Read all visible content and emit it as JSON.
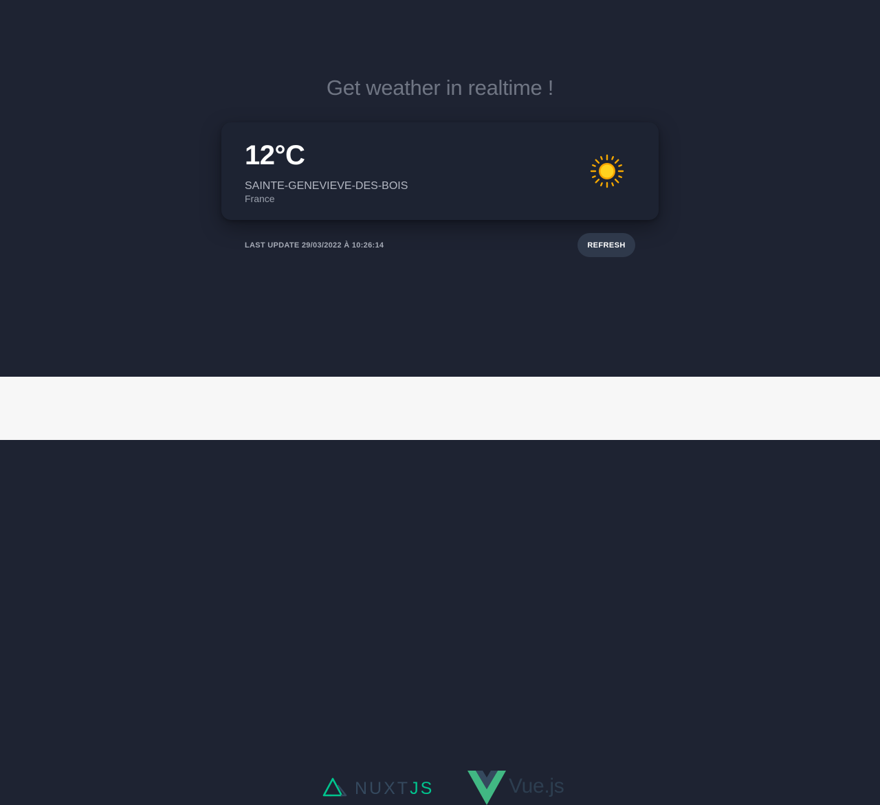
{
  "header": {
    "headline": "Get weather in realtime !"
  },
  "weather": {
    "temperature": "12°C",
    "city": "SAINTE-GENEVIEVE-DES-BOIS",
    "country": "France",
    "condition_icon": "sun-icon",
    "icon_color": "#f5b700"
  },
  "status": {
    "last_update": "LAST UPDATE 29/03/2022 À 10:26:14",
    "refresh_label": "REFRESH"
  },
  "footer": {
    "nuxt_word": "NUXT",
    "nuxt_js": "JS",
    "vue_label": "Vue.js",
    "colors": {
      "nuxt_green": "#00c58e",
      "nuxt_dark": "#35495e",
      "vue_green": "#41b883",
      "vue_dark": "#35495e"
    }
  }
}
